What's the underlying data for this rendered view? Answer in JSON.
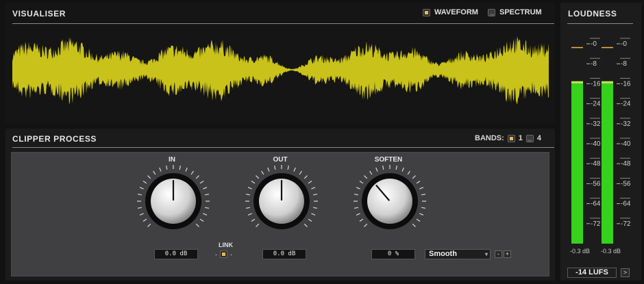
{
  "visualiser": {
    "title": "VISUALISER",
    "options": [
      {
        "label": "WAVEFORM",
        "selected": true
      },
      {
        "label": "SPECTRUM",
        "selected": false
      }
    ],
    "waveform_color": "#c9c21a"
  },
  "clipper": {
    "title": "CLIPPER PROCESS",
    "bands_label": "BANDS:",
    "bands": [
      {
        "label": "1",
        "selected": true
      },
      {
        "label": "4",
        "selected": false
      }
    ],
    "knobs": [
      {
        "label": "IN",
        "value": "0.0 dB",
        "level": 0.5
      },
      {
        "label": "OUT",
        "value": "0.0 dB",
        "level": 0.5
      },
      {
        "label": "SOFTEN",
        "value": "0 %",
        "level": 0.35
      }
    ],
    "link": {
      "label": "LINK",
      "minus": "-",
      "plus": "-",
      "enabled": true
    },
    "mode": {
      "selected": "Smooth",
      "dec": "-",
      "inc": "+"
    }
  },
  "loudness": {
    "title": "LOUDNESS",
    "scale": [
      "-0",
      "-8",
      "-16",
      "-24",
      "-32",
      "-40",
      "-48",
      "-56",
      "-64",
      "-72"
    ],
    "meters": [
      {
        "level": -15,
        "peak": -1.5,
        "readout": "-0.3 dB"
      },
      {
        "level": -15,
        "peak": -1.5,
        "readout": "-0.3 dB"
      }
    ],
    "target": "-14 LUFS",
    "next": ">",
    "accent": "#f3b455",
    "meter_color": "#35d21b"
  }
}
